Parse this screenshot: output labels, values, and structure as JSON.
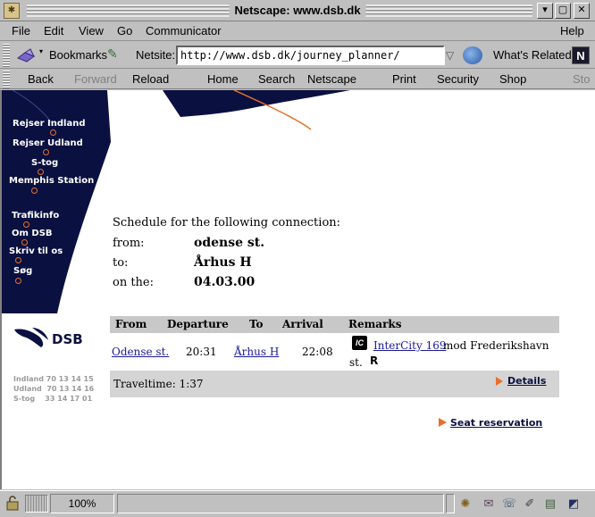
{
  "window": {
    "title": "Netscape: www.dsb.dk"
  },
  "menu": {
    "items": [
      "File",
      "Edit",
      "View",
      "Go",
      "Communicator",
      "Help"
    ]
  },
  "location": {
    "bookmarks_label": "Bookmarks",
    "netsite_label": "Netsite:",
    "url": "http://www.dsb.dk/journey_planner/",
    "whats_related_label": "What's Related",
    "netscape_logo": "N"
  },
  "toolbar": {
    "back": "Back",
    "forward": "Forward",
    "reload": "Reload",
    "home": "Home",
    "search": "Search",
    "netscape": "Netscape",
    "print": "Print",
    "security": "Security",
    "shop": "Shop",
    "stop": "Sto"
  },
  "sidebar": {
    "items": [
      "Rejser Indland",
      "Rejser Udland",
      "S-tog",
      "Memphis Station",
      "Trafikinfo",
      "Om DSB",
      "Skriv til os",
      "Søg"
    ],
    "logo_text": "DSB",
    "phones": [
      "Indland 70 13 14 15",
      "Udland  70 13 14 16",
      "S-tog    33 14 17 01"
    ]
  },
  "schedule": {
    "heading": "Schedule for the following connection:",
    "from_label": "from:",
    "from_value": "odense st.",
    "to_label": "to:",
    "to_value": "Århus H",
    "date_label": "on the:",
    "date_value": "04.03.00"
  },
  "results": {
    "headers": [
      "From",
      "Departure",
      "To",
      "Arrival",
      "Remarks"
    ],
    "row": {
      "from": "Odense st.",
      "departure": "20:31",
      "to": "Århus H",
      "arrival": "22:08",
      "train_badge": "IC",
      "train_link": "InterCity 169",
      "remark_text": "mod Frederikshavn",
      "remark_text2": "st.",
      "remark_flag": "R"
    },
    "traveltime": "Traveltime: 1:37",
    "details_label": "Details",
    "seat_label": "Seat reservation"
  },
  "status": {
    "progress": "100%"
  },
  "colors": {
    "navy": "#0a1040",
    "accent": "#e8702a",
    "link": "#1a1a9a"
  }
}
